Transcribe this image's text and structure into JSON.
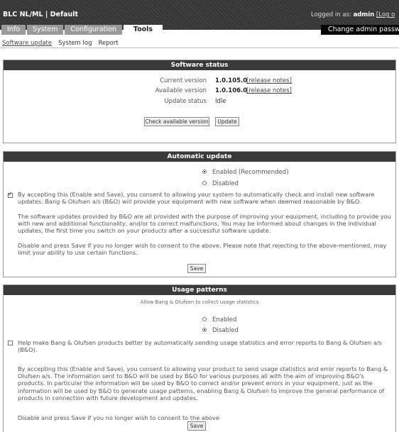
{
  "header": {
    "title": "BLC NL/ML | Default",
    "logged_in_prefix": "Logged in as:",
    "username": "admin",
    "logout_label": "[Log o"
  },
  "tabs": [
    {
      "label": "Info"
    },
    {
      "label": "System"
    },
    {
      "label": "Configuration"
    },
    {
      "label": "Tools",
      "active": true
    }
  ],
  "admin_button": "Change admin passwor",
  "subnav": [
    "Software update",
    "System log",
    "Report"
  ],
  "software_status": {
    "title": "Software status",
    "current_version_label": "Current version",
    "current_version": "1.0.105.0",
    "available_version_label": "Available version",
    "available_version": "1.0.106.0",
    "release_notes": "[release notes]",
    "update_status_label": "Update status",
    "update_status": "Idle",
    "check_button": "Check available version",
    "update_button": "Update"
  },
  "automatic_update": {
    "title": "Automatic update",
    "option_enabled": "Enabled (Recommended)",
    "option_disabled": "Disabled",
    "selected": "enabled",
    "consent_checked": true,
    "consent_text": "By accepting this (Enable and Save), you consent to allowing your system to automatically check and install new software updates. Bang & Olufsen a/s (B&O) will provide your equipment with new software when deemed reasonable by B&O.",
    "para1": "The software updates provided by B&O are all provided with the purpose of improving your equipment, including to provide you with new and additional functionality, and/or to correct malfunctions. You may be informed about changes in the individual updates, the first time you switch on your products after a successful software update.",
    "para2": "Disable and press Save if you no longer wish to consent to the above. Please note that rejecting to the above-mentioned, may limit your ability to use certain functions.",
    "save_button": "Save"
  },
  "usage_patterns": {
    "title": "Usage patterns",
    "subtitle": "Allow Bang & Olufsen to collect usage statistics",
    "option_enabled": "Enabled",
    "option_disabled": "Disabled",
    "selected": "disabled",
    "consent_checked": false,
    "consent_text": "Help make Bang & Olufsen products better by automatically sending usage statistics and error reports to Bang & Olufsen a/s (B&O).",
    "para1": "By accepting this (Enable and Save), you consent to allowing your product to send usage statistics and error reports to Bang & Olufsen a/s. The information sent to B&O will be used by B&O for various purposes all with the aim of improving B&O's products. In particular the information will be used by B&O to correct and/or prevent errors in your equipment, just as the information will be used by B&O to generate usage patterns, enabling Bang & Olufsen to improve the general performance of products in connection with future development and updates.",
    "para2": "Disable and press Save if you no longer wish to consent to the above",
    "save_button": "Save"
  }
}
